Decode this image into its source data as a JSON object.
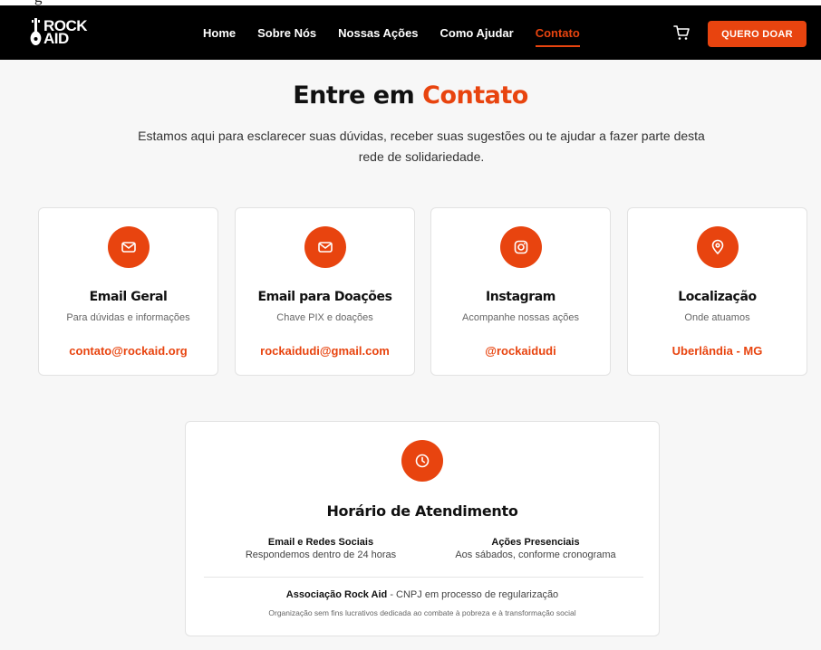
{
  "top_strip": {
    "text": "g"
  },
  "header": {
    "logo": {
      "line1": "ROCK",
      "line2": "AID"
    },
    "nav": [
      {
        "label": "Home",
        "active": false
      },
      {
        "label": "Sobre Nós",
        "active": false
      },
      {
        "label": "Nossas Ações",
        "active": false
      },
      {
        "label": "Como Ajudar",
        "active": false
      },
      {
        "label": "Contato",
        "active": true
      }
    ],
    "cart_icon": "cart-icon",
    "donate_label": "QUERO DOAR"
  },
  "hero": {
    "title_prefix": "Entre em",
    "title_accent": "Contato",
    "subtitle": "Estamos aqui para esclarecer suas dúvidas, receber suas sugestões ou te ajudar a fazer parte desta rede de solidariedade."
  },
  "cards": [
    {
      "icon": "mail-icon",
      "title": "Email Geral",
      "desc": "Para dúvidas e informações",
      "link": "contato@rockaid.org"
    },
    {
      "icon": "mail-icon",
      "title": "Email para Doações",
      "desc": "Chave PIX e doações",
      "link": "rockaidudi@gmail.com"
    },
    {
      "icon": "instagram-icon",
      "title": "Instagram",
      "desc": "Acompanhe nossas ações",
      "link": "@rockaidudi"
    },
    {
      "icon": "map-pin-icon",
      "title": "Localização",
      "desc": "Onde atuamos",
      "link": "Uberlândia - MG"
    }
  ],
  "hours": {
    "icon": "clock-icon",
    "title": "Horário de Atendimento",
    "columns": [
      {
        "heading": "Email e Redes Sociais",
        "detail": "Respondemos dentro de 24 horas"
      },
      {
        "heading": "Ações Presenciais",
        "detail": "Aos sábados, conforme cronograma"
      }
    ],
    "org_name": "Associação Rock Aid",
    "org_status": " - CNPJ em processo de regularização",
    "note": "Organização sem fins lucrativos dedicada ao combate à pobreza e à transformação social"
  },
  "colors": {
    "accent": "#e8440f",
    "nav_bg": "#000000",
    "page_bg": "#f7f7f7",
    "card_bg": "#ffffff"
  }
}
